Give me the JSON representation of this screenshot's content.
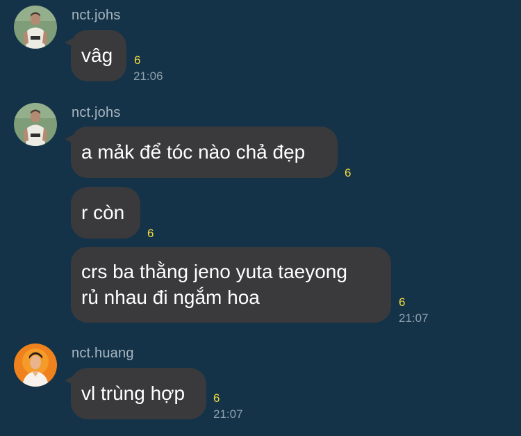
{
  "chat": {
    "groups": [
      {
        "sender": "nct.johs",
        "avatar_icon": "user-avatar-johs",
        "messages": [
          {
            "text": "vâg",
            "read_count": "6",
            "time": "21:06"
          }
        ]
      },
      {
        "sender": "nct.johs",
        "avatar_icon": "user-avatar-johs",
        "messages": [
          {
            "text": "a mảk để tóc nào chả đẹp",
            "read_count": "6"
          },
          {
            "text": "r còn",
            "read_count": "6"
          },
          {
            "line1": "crs ba thằng jeno yuta taeyong",
            "line2": "rủ nhau đi ngắm hoa",
            "read_count": "6",
            "time": "21:07"
          }
        ]
      },
      {
        "sender": "nct.huang",
        "avatar_icon": "user-avatar-huang",
        "messages": [
          {
            "text": "vl trùng hợp",
            "read_count": "6",
            "time": "21:07"
          }
        ]
      }
    ]
  },
  "colors": {
    "background": "#143349",
    "bubble": "#3a3a3c",
    "read_count": "#f3dc3e",
    "timestamp": "#8fa0ad",
    "sender_name": "#a9b6c0"
  }
}
